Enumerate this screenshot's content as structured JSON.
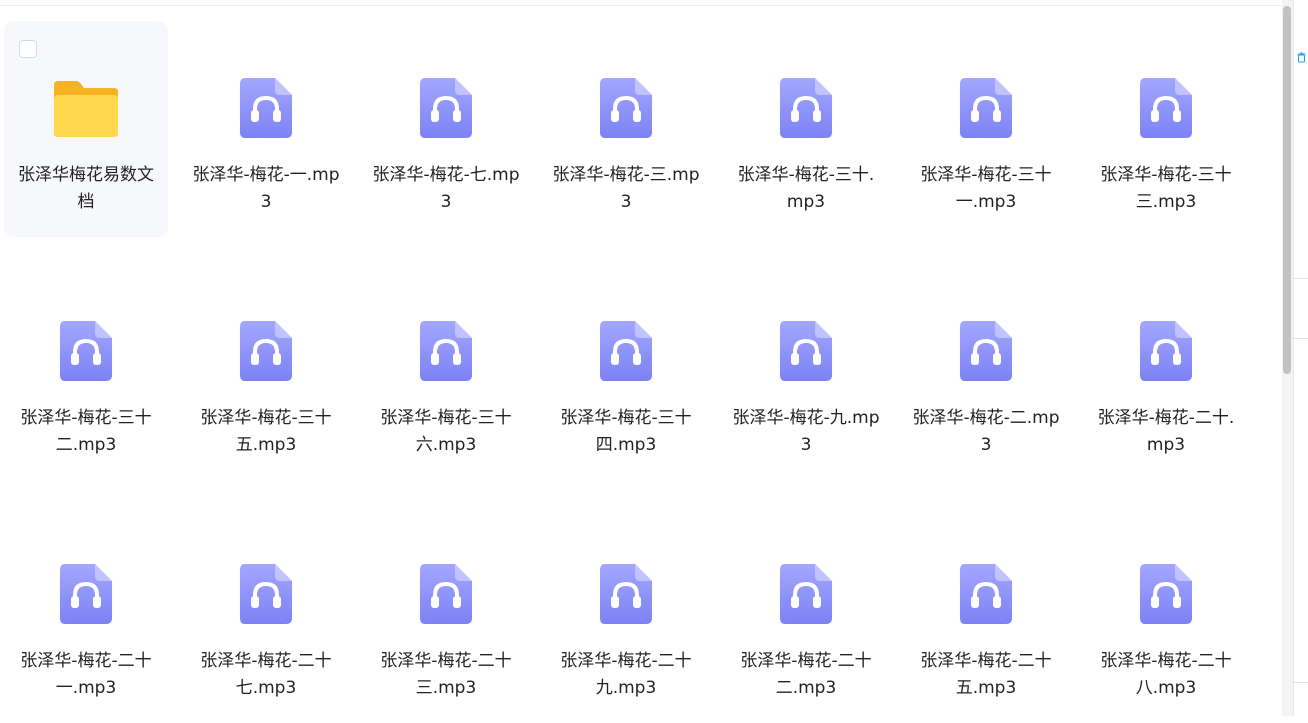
{
  "items": [
    {
      "type": "folder",
      "name": "张泽华梅花易数文档",
      "selected": true
    },
    {
      "type": "audio",
      "name": "张泽华-梅花-一.mp3"
    },
    {
      "type": "audio",
      "name": "张泽华-梅花-七.mp3"
    },
    {
      "type": "audio",
      "name": "张泽华-梅花-三.mp3"
    },
    {
      "type": "audio",
      "name": "张泽华-梅花-三十.mp3"
    },
    {
      "type": "audio",
      "name": "张泽华-梅花-三十一.mp3"
    },
    {
      "type": "audio",
      "name": "张泽华-梅花-三十三.mp3"
    },
    {
      "type": "audio",
      "name": "张泽华-梅花-三十二.mp3"
    },
    {
      "type": "audio",
      "name": "张泽华-梅花-三十五.mp3"
    },
    {
      "type": "audio",
      "name": "张泽华-梅花-三十六.mp3"
    },
    {
      "type": "audio",
      "name": "张泽华-梅花-三十四.mp3"
    },
    {
      "type": "audio",
      "name": "张泽华-梅花-九.mp3"
    },
    {
      "type": "audio",
      "name": "张泽华-梅花-二.mp3"
    },
    {
      "type": "audio",
      "name": "张泽华-梅花-二十.mp3"
    },
    {
      "type": "audio",
      "name": "张泽华-梅花-二十一.mp3"
    },
    {
      "type": "audio",
      "name": "张泽华-梅花-二十七.mp3"
    },
    {
      "type": "audio",
      "name": "张泽华-梅花-二十三.mp3"
    },
    {
      "type": "audio",
      "name": "张泽华-梅花-二十九.mp3"
    },
    {
      "type": "audio",
      "name": "张泽华-梅花-二十二.mp3"
    },
    {
      "type": "audio",
      "name": "张泽华-梅花-二十五.mp3"
    },
    {
      "type": "audio",
      "name": "张泽华-梅花-二十八.mp3"
    }
  ],
  "icons": {
    "folder": "folder-icon",
    "audio": "audio-file-icon",
    "side": "trash-icon"
  },
  "colors": {
    "audio_top": "#a3a7ff",
    "audio_bottom": "#7c82f4",
    "folder_back": "#f7b223",
    "folder_front": "#ffd84d",
    "selected_bg": "#f7f8fc",
    "accent": "#1a9cf0"
  }
}
